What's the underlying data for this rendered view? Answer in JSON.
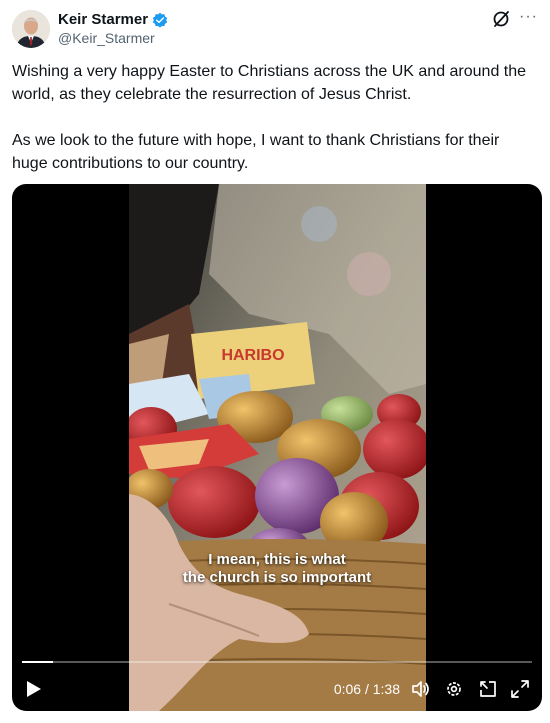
{
  "author": {
    "name": "Keir Starmer",
    "handle": "@Keir_Starmer",
    "verified": true
  },
  "tweet": {
    "paragraphs": [
      "Wishing a very happy Easter to Christians across the UK and around the world, as they celebrate the resurrection of Jesus Christ.",
      "As we look to the future with hope, I want to thank Christians for their huge contributions to our country."
    ]
  },
  "video": {
    "packet_label": "HARIBO",
    "caption_line1": "I mean, this is what",
    "caption_line2": "the church is so important",
    "time_display": "0:06 / 1:38",
    "progress_fraction": 0.06
  },
  "icons": {
    "verified": "verified-badge-icon",
    "grok": "grok-icon",
    "more": "more-icon",
    "play": "play-icon",
    "volume": "volume-icon",
    "settings": "settings-gear-icon",
    "pip": "picture-in-picture-icon",
    "fullscreen": "fullscreen-icon"
  },
  "colors": {
    "verified_blue": "#1d9bf0",
    "secondary_text": "#536471"
  }
}
